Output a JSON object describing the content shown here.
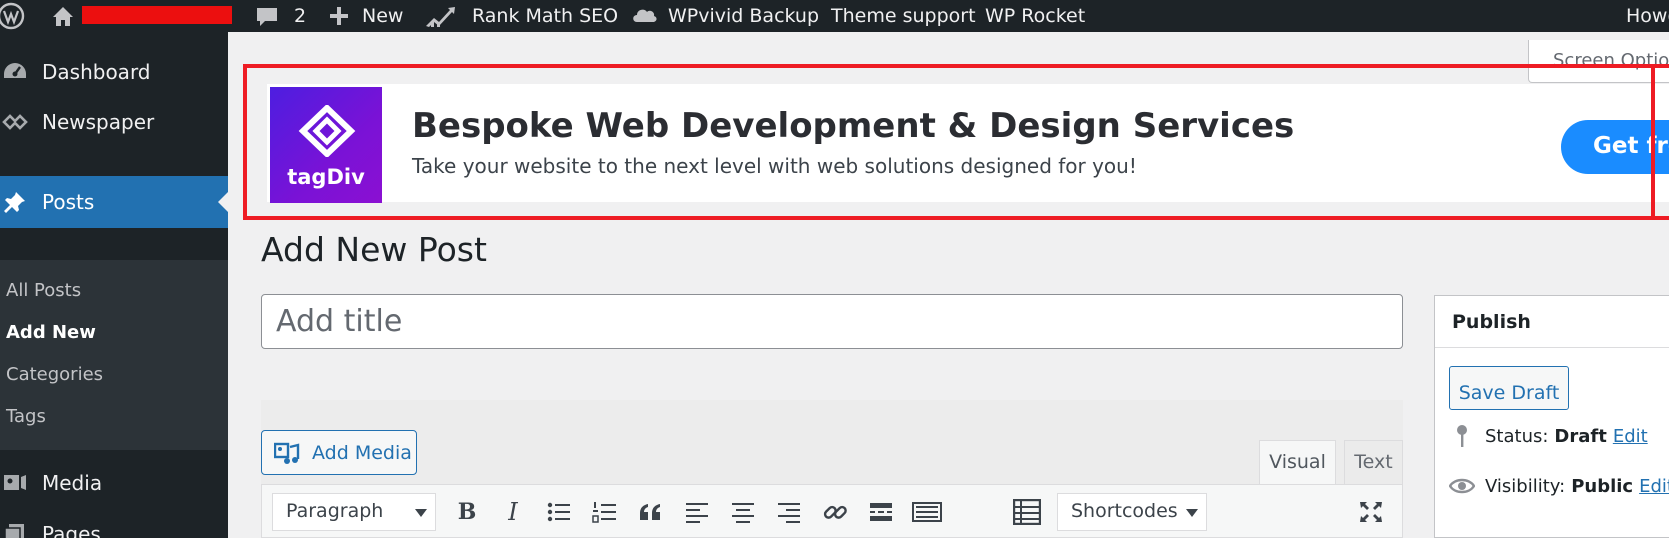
{
  "admin_bar": {
    "comments_count": "2",
    "new_label": "New",
    "rank_math_label": "Rank Math SEO",
    "wpvivid_label": "WPvivid Backup",
    "theme_support_label": "Theme support",
    "wp_rocket_label": "WP Rocket",
    "howdy_label": "Howdy"
  },
  "sidebar": {
    "dashboard_label": "Dashboard",
    "newspaper_label": "Newspaper",
    "posts_label": "Posts",
    "submenu": {
      "all_posts": "All Posts",
      "add_new": "Add New",
      "categories": "Categories",
      "tags": "Tags"
    },
    "media_label": "Media",
    "pages_label": "Pages"
  },
  "screen_options_label": "Screen Options",
  "banner": {
    "logo_text": "tagDiv",
    "title": "Bespoke Web Development & Design Services",
    "subtitle": "Take your website to the next level with web solutions designed for you!",
    "cta_label": "Get free quote",
    "highlight_color": "#ee1c24",
    "cta_color": "#1a8cff"
  },
  "page": {
    "title": "Add New Post",
    "title_placeholder": "Add title"
  },
  "editor": {
    "add_media_label": "Add Media",
    "tab_visual": "Visual",
    "tab_text": "Text",
    "format_value": "Paragraph",
    "shortcodes_value": "Shortcodes"
  },
  "publish": {
    "heading": "Publish",
    "save_draft_label": "Save Draft",
    "status_label": "Status:",
    "status_value": "Draft",
    "visibility_label": "Visibility:",
    "visibility_value": "Public",
    "edit_label": "Edit"
  },
  "colors": {
    "admin_bg": "#1d2327",
    "accent": "#2271b1"
  }
}
